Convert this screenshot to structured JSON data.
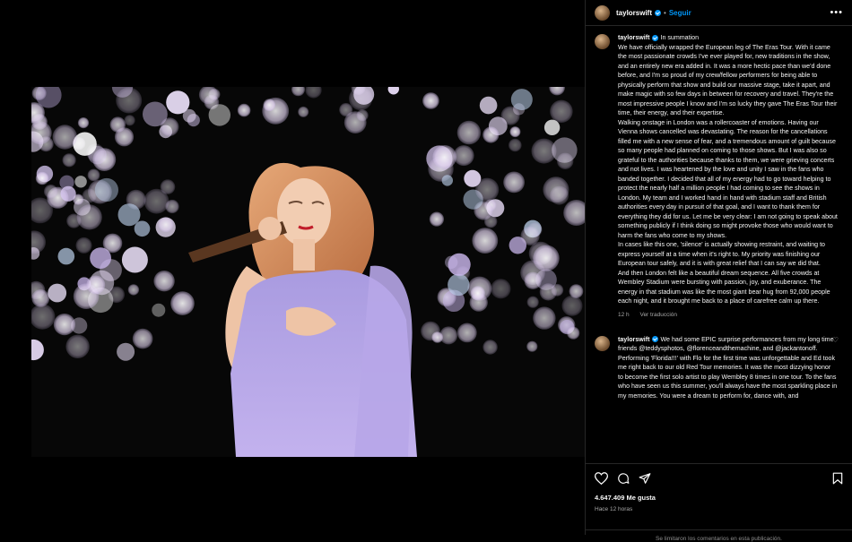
{
  "header": {
    "username": "taylorswift",
    "separator": "•",
    "follow_label": "Seguir",
    "more_label": "•••"
  },
  "caption": {
    "username": "taylorswift",
    "text": "In summation\nWe have officially wrapped the European leg of The Eras Tour. With it came the most passionate crowds I've ever played for, new traditions in the show, and an entirely new era added in. It was a more hectic pace than we'd done before, and I'm so proud of my crew/fellow performers for being able to physically perform that show and build our massive stage, take it apart, and make magic with so few days in between for recovery and travel. They're the most impressive people I know and I'm so lucky they gave The Eras Tour their time, their energy, and their expertise.\nWalking onstage in London was a rollercoaster of emotions. Having our Vienna shows cancelled was devastating. The reason for the cancellations filled me with a new sense of fear, and a tremendous amount of guilt because so many people had planned on coming to those shows. But I was also so grateful to the authorities because thanks to them, we were grieving concerts and not lives. I was heartened by the love and unity I saw in the fans who banded together. I decided that all of my energy had to go toward helping to protect the nearly half a million people I had coming to see the shows in London. My team and I worked hand in hand with stadium staff and British authorities every day in pursuit of that goal, and I want to thank them for everything they did for us. Let me be very clear: I am not going to speak about something publicly if I think doing so might provoke those who would want to harm the fans who come to my shows.\nIn cases like this one, 'silence' is actually showing restraint, and waiting to express yourself at a time when it's right to. My priority was finishing our European tour safely, and it is with great relief that I can say we did that.\nAnd then London felt like a beautiful dream sequence. All five crowds at Wembley Stadium were bursting with passion, joy, and exuberance. The energy in that stadium was like the most giant bear hug from 92,000 people each night, and it brought me back to a place of carefree calm up there.",
    "time": "12 h",
    "translate_label": "Ver traducción"
  },
  "comment": {
    "username": "taylorswift",
    "text": "We had some EPIC surprise performances from my long time friends @teddysphotos, @florenceandthemachine, and @jackantonoff. Performing 'Florida!!!' with Flo for the first time was unforgettable and Ed took me right back to our old Red Tour memories. It was the most dizzying honor to become the first solo artist to play Wembley 8 times in one tour. To the fans who have seen us this summer, you'll always have the most sparkling place in my memories. You were a dream to perform for, dance with, and"
  },
  "footer": {
    "likes": "4.647.409 Me gusta",
    "time": "Hace 12 horas",
    "limited_notice": "Se limitaron los comentarios en esta publicación."
  },
  "carousel": {
    "slide_count": 10,
    "active_index": 0
  },
  "colors": {
    "accent": "#0095f6",
    "background": "#000000",
    "border": "#262626",
    "muted": "#a8a8a8"
  },
  "icons": [
    "verified-icon",
    "more-icon",
    "chevron-right-icon",
    "heart-icon",
    "comment-icon",
    "share-icon",
    "bookmark-icon"
  ]
}
